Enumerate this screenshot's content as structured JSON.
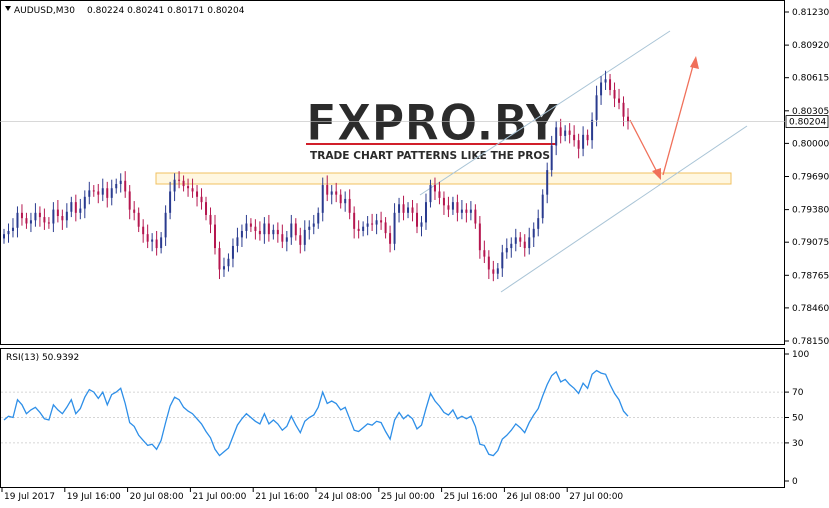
{
  "header": {
    "symbol": "AUDUSD,M30",
    "ohlc": "0.80224 0.80241 0.80171 0.80204"
  },
  "watermark": {
    "brand": "FXPRO.BY",
    "tagline": "TRADE CHART PATTERNS LIKE THE PROS"
  },
  "colors": {
    "bull_candle": "#2a3b8f",
    "bear_candle": "#b5174f",
    "rsi_line": "#2e8fe8",
    "channel": "#a9c4d6",
    "zone_border": "#f0c060",
    "zone_fill": "#fff7e0",
    "arrow": "#f0705a",
    "watermark_text": "#2b2b2b",
    "watermark_accent": "#d11f2a"
  },
  "chart_data": [
    {
      "type": "candlestick",
      "title": "AUDUSD,M30",
      "ylim": [
        0.7815,
        0.8123
      ],
      "yticks": [
        "0.81230",
        "0.80920",
        "0.80615",
        "0.80305",
        "0.80000",
        "0.79690",
        "0.79380",
        "0.79075",
        "0.78765",
        "0.78460",
        "0.78150"
      ],
      "ytick_values": [
        0.8123,
        0.8092,
        0.80615,
        0.80305,
        0.8,
        0.7969,
        0.7938,
        0.79075,
        0.78765,
        0.7846,
        0.7815
      ],
      "current_price": "0.80204",
      "current_price_value": 0.80204,
      "xticks": [
        "19 Jul 2017",
        "19 Jul 16:00",
        "20 Jul 08:00",
        "21 Jul 00:00",
        "21 Jul 16:00",
        "24 Jul 08:00",
        "25 Jul 00:00",
        "25 Jul 16:00",
        "26 Jul 08:00",
        "27 Jul 00:00"
      ],
      "close_series": [
        0.7915,
        0.7918,
        0.7921,
        0.7935,
        0.793,
        0.7925,
        0.7928,
        0.7935,
        0.7931,
        0.7926,
        0.7925,
        0.7938,
        0.7932,
        0.7928,
        0.7936,
        0.7945,
        0.7935,
        0.7939,
        0.795,
        0.7956,
        0.7955,
        0.7952,
        0.7958,
        0.7949,
        0.7958,
        0.7962,
        0.7965,
        0.7955,
        0.7938,
        0.7935,
        0.7922,
        0.7915,
        0.7908,
        0.791,
        0.7902,
        0.7912,
        0.7935,
        0.7955,
        0.7966,
        0.7965,
        0.796,
        0.7958,
        0.7955,
        0.795,
        0.7945,
        0.7933,
        0.7924,
        0.7902,
        0.7882,
        0.7885,
        0.7892,
        0.7904,
        0.7912,
        0.7918,
        0.7925,
        0.7922,
        0.7918,
        0.7915,
        0.7925,
        0.7915,
        0.7919,
        0.7915,
        0.7908,
        0.7912,
        0.7925,
        0.7914,
        0.7905,
        0.7919,
        0.7922,
        0.7925,
        0.7935,
        0.7961,
        0.7952,
        0.7955,
        0.7952,
        0.7944,
        0.7948,
        0.7935,
        0.792,
        0.7918,
        0.7922,
        0.7925,
        0.7924,
        0.7928,
        0.7926,
        0.7916,
        0.7906,
        0.7935,
        0.7943,
        0.7935,
        0.794,
        0.7935,
        0.7922,
        0.7926,
        0.7945,
        0.7961,
        0.7955,
        0.7949,
        0.7942,
        0.7938,
        0.7945,
        0.7935,
        0.7938,
        0.7935,
        0.7938,
        0.7925,
        0.79,
        0.7894,
        0.7882,
        0.7878,
        0.7883,
        0.7898,
        0.7902,
        0.7906,
        0.7912,
        0.7908,
        0.7902,
        0.7912,
        0.792,
        0.793,
        0.7952,
        0.7975,
        0.7998,
        0.8015,
        0.8007,
        0.8012,
        0.8008,
        0.8003,
        0.7995,
        0.8008,
        0.8003,
        0.8022,
        0.8045,
        0.8057,
        0.806,
        0.805,
        0.8042,
        0.8038,
        0.8025,
        0.802
      ]
    },
    {
      "type": "line",
      "title": "RSI(13) 50.9392",
      "ylim": [
        0,
        100
      ],
      "yticks": [
        "100",
        "70",
        "50",
        "30",
        "0"
      ],
      "ytick_values": [
        100,
        70,
        50,
        30,
        0
      ],
      "levels": [
        70,
        50,
        30
      ],
      "last_value": 50.9392,
      "series": [
        {
          "name": "RSI(13)",
          "values": [
            48,
            51,
            50,
            64,
            60,
            53,
            56,
            58,
            54,
            49,
            48,
            60,
            56,
            53,
            58,
            64,
            53,
            57,
            66,
            72,
            70,
            65,
            70,
            60,
            68,
            70,
            73,
            61,
            46,
            43,
            36,
            32,
            28,
            29,
            25,
            32,
            46,
            59,
            66,
            64,
            58,
            55,
            53,
            49,
            45,
            39,
            34,
            25,
            20,
            23,
            26,
            35,
            44,
            49,
            53,
            50,
            47,
            45,
            53,
            45,
            48,
            45,
            40,
            43,
            51,
            44,
            38,
            47,
            50,
            52,
            58,
            70,
            61,
            63,
            61,
            56,
            58,
            49,
            40,
            39,
            42,
            45,
            44,
            47,
            46,
            39,
            33,
            48,
            54,
            49,
            52,
            49,
            41,
            44,
            57,
            69,
            63,
            59,
            54,
            52,
            56,
            49,
            51,
            49,
            51,
            43,
            29,
            28,
            21,
            20,
            24,
            33,
            36,
            40,
            45,
            42,
            38,
            46,
            52,
            57,
            67,
            76,
            83,
            86,
            78,
            80,
            76,
            73,
            69,
            77,
            73,
            84,
            87,
            85,
            84,
            76,
            69,
            64,
            55,
            51
          ]
        }
      ]
    }
  ]
}
